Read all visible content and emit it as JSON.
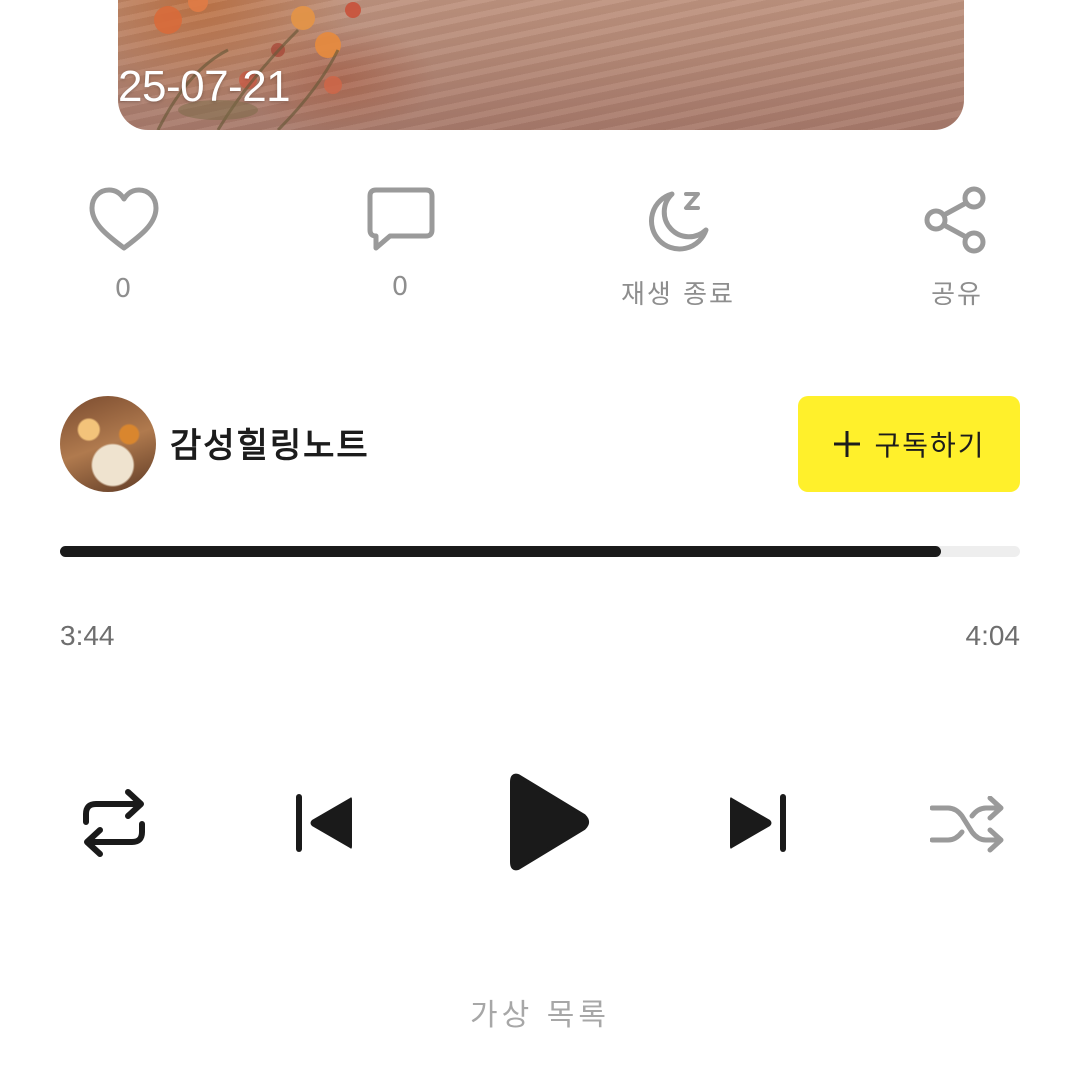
{
  "cover": {
    "date": "25-07-21"
  },
  "actions": [
    {
      "icon": "heart-icon",
      "label": "0"
    },
    {
      "icon": "comment-icon",
      "label": "0"
    },
    {
      "icon": "sleep-timer-icon",
      "label": "재생 종료"
    },
    {
      "icon": "share-icon",
      "label": "공유"
    }
  ],
  "channel": {
    "name": "감성힐링노트",
    "subscribe_label": "구독하기"
  },
  "player": {
    "progress": 0.918,
    "elapsed": "3:44",
    "duration": "4:04"
  },
  "footer": {
    "text": "가상 목록"
  },
  "colors": {
    "accent": "#fff02b",
    "progress_fill": "#1a1a1a",
    "progress_track": "#eeeeee",
    "icon_gray": "#9a9a9a",
    "icon_dark": "#1a1a1a"
  }
}
